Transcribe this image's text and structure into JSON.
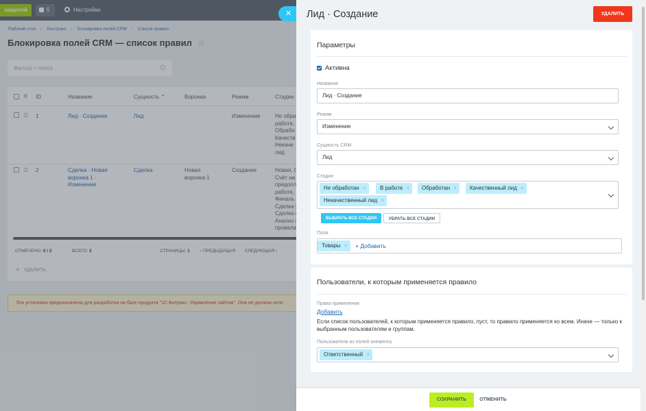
{
  "background": {
    "top_bar": {
      "protect_button": "защитой",
      "counter": "5",
      "settings": "Настройки"
    },
    "breadcrumbs": [
      "Рабочий стол",
      "Бестранс",
      "Блокировка полей CRM",
      "Список правил"
    ],
    "page_title": "Блокировка полей CRM — список правил",
    "filter_placeholder": "Фильтр + поиск",
    "grid": {
      "columns": [
        "ID",
        "Название",
        "Сущность",
        "Воронка",
        "Режим",
        "Стадии"
      ],
      "rows": [
        {
          "id": "1",
          "name": "Лид · Создание",
          "entity": "Лид",
          "funnel": "",
          "mode": "Изменение",
          "stages": "Не обра\nработе,\nОбрабо\nКачеств\nНекаче\nлид"
        },
        {
          "id": "2",
          "name": "Сделка · Новая\nворонка 1 ·\nИзменение",
          "entity": "Сделка",
          "funnel": "Новая\nворонка 1",
          "mode": "Создание",
          "stages": "Новая, С\nСчёт на\nпредопл\nработе,\nФиналь\nСделка у\nСделка п\nАнализ п\nпровала"
        }
      ],
      "footer": {
        "selected_label": "ОТМЕЧЕНО:",
        "selected_value": "0 / 2",
        "total_label": "ВСЕГО:",
        "total_value": "2",
        "pages_label": "СТРАНИЦЫ:",
        "pages_value": "1",
        "prev": "ПРЕДЫДУЩАЯ",
        "next": "СЛЕДУЮЩАЯ"
      },
      "delete_action": "УДАЛИТЬ"
    },
    "warning": "Эта установка предназначена для разработки на базе продукта \"1С-Битрикс: Управление сайтом\". Она не должна испо"
  },
  "panel": {
    "title": "Лид · Создание",
    "delete_button": "УДАЛИТЬ",
    "params": {
      "section_title": "Параметры",
      "active_label": "Активна",
      "active_checked": true,
      "name_label": "Название",
      "name_value": "Лид · Создание",
      "mode_label": "Режим",
      "mode_value": "Изменение",
      "entity_label": "Сущность CRM",
      "entity_value": "Лид",
      "stages_label": "Стадии",
      "stages": [
        "Не обработан",
        "В работе",
        "Обработан",
        "Качественный лид",
        "Некачественный лид"
      ],
      "select_all_button": "ВЫБРАТЬ ВСЕ СТАДИИ",
      "clear_all_button": "УБРАТЬ ВСЕ СТАДИИ",
      "fields_label": "Поля",
      "fields": [
        "Товары"
      ],
      "add_field": "+ Добавить"
    },
    "users": {
      "section_title": "Пользователи, к которым применяется правило",
      "rights_label": "Права применения",
      "add_link": "Добавить",
      "help_text": "Если список пользователей, к которым применяется правило, пуст, то правило применяется ко всем. Иначе — только к выбранным пользователям и группам.",
      "element_users_label": "Пользователи из полей элемента",
      "element_users": [
        "Ответственный"
      ]
    },
    "footer": {
      "save": "СОХРАНИТЬ",
      "cancel": "ОТМЕНИТЬ"
    }
  },
  "colors": {
    "accent_blue": "#2fc6f6",
    "delete_red": "#f1361b",
    "save_green": "#bbed21",
    "tag_blue": "#bcedfc",
    "link": "#2067b0"
  },
  "icons": {
    "close": "close-icon",
    "settings": "gear-icon",
    "favorite": "star-icon",
    "search": "search-icon"
  }
}
